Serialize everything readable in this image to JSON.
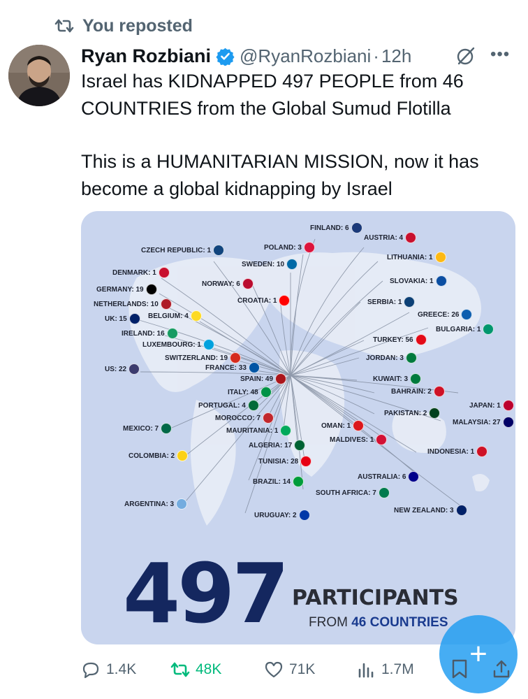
{
  "repost": {
    "label": "You reposted",
    "icon": "retweet-icon"
  },
  "author": {
    "name": "Ryan Rozbiani",
    "handle": "@RyanRozbiani",
    "separator": "·",
    "time": "12h",
    "verified": true
  },
  "tweet": {
    "line1": "Israel has KIDNAPPED 497 PEOPLE from 46 COUNTRIES from the Global Sumud Flotilla",
    "line2": "This is a HUMANITARIAN MISSION, now it has become a global kidnapping by Israel"
  },
  "infographic": {
    "big_number": "497",
    "big_label": "PARTICIPANTS",
    "sub_prefix": "FROM ",
    "sub_accent": "46 COUNTRIES",
    "countries": [
      {
        "label": "FINLAND: 6"
      },
      {
        "label": "AUSTRIA: 4"
      },
      {
        "label": "POLAND: 3"
      },
      {
        "label": "CZECH REPUBLIC: 1"
      },
      {
        "label": "LITHUANIA: 1"
      },
      {
        "label": "SWEDEN: 10"
      },
      {
        "label": "DENMARK: 1"
      },
      {
        "label": "NORWAY: 6"
      },
      {
        "label": "SLOVAKIA: 1"
      },
      {
        "label": "GERMANY: 19"
      },
      {
        "label": "CROATIA: 1"
      },
      {
        "label": "SERBIA: 1"
      },
      {
        "label": "NETHERLANDS: 10"
      },
      {
        "label": "GREECE: 26"
      },
      {
        "label": "UK: 15"
      },
      {
        "label": "BELGIUM: 4"
      },
      {
        "label": "BULGARIA: 1"
      },
      {
        "label": "IRELAND: 16"
      },
      {
        "label": "TURKEY: 56"
      },
      {
        "label": "LUXEMBOURG: 1"
      },
      {
        "label": "SWITZERLAND: 19"
      },
      {
        "label": "JORDAN: 3"
      },
      {
        "label": "FRANCE: 33"
      },
      {
        "label": "US: 22"
      },
      {
        "label": "SPAIN: 49"
      },
      {
        "label": "KUWAIT: 3"
      },
      {
        "label": "ITALY: 48"
      },
      {
        "label": "BAHRAIN: 2"
      },
      {
        "label": "PORTUGAL: 4"
      },
      {
        "label": "JAPAN: 1"
      },
      {
        "label": "PAKISTAN: 2"
      },
      {
        "label": "MOROCCO: 7"
      },
      {
        "label": "MALAYSIA: 27"
      },
      {
        "label": "MEXICO: 7"
      },
      {
        "label": "MAURITANIA: 1"
      },
      {
        "label": "OMAN: 1"
      },
      {
        "label": "MALDIVES: 1"
      },
      {
        "label": "ALGERIA: 17"
      },
      {
        "label": "INDONESIA: 1"
      },
      {
        "label": "COLOMBIA: 2"
      },
      {
        "label": "TUNISIA: 28"
      },
      {
        "label": "AUSTRALIA: 6"
      },
      {
        "label": "BRAZIL: 14"
      },
      {
        "label": "SOUTH AFRICA: 7"
      },
      {
        "label": "ARGENTINA: 3"
      },
      {
        "label": "NEW ZEALAND: 3"
      },
      {
        "label": "URUGUAY: 2"
      }
    ]
  },
  "actions": {
    "replies": "1.4K",
    "reposts": "48K",
    "likes": "71K",
    "views": "1.7M"
  },
  "colors": {
    "accent": "#1d9bf0",
    "repost_green": "#00ba7c",
    "map_bg": "#c9d5ee",
    "number_navy": "#14275f"
  }
}
